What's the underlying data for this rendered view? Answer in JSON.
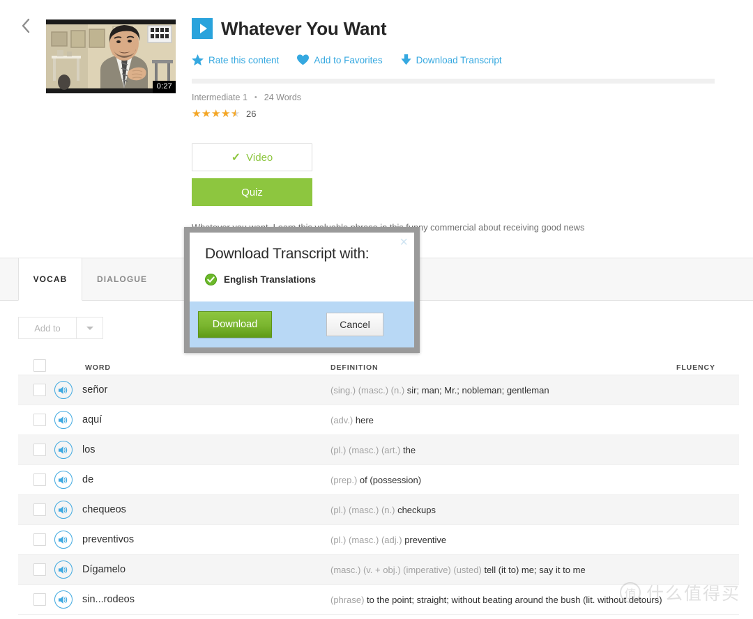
{
  "header": {
    "back_icon": "chevron-left-icon",
    "thumbnail": {
      "duration": "0:27",
      "alt": "video-thumbnail"
    },
    "play_icon": "play-icon",
    "title": "Whatever You Want",
    "actions": [
      {
        "icon": "star-icon",
        "label": "Rate this content"
      },
      {
        "icon": "heart-icon",
        "label": "Add to Favorites"
      },
      {
        "icon": "download-arrow-icon",
        "label": "Download Transcript"
      }
    ],
    "progress_percent": 0,
    "meta": {
      "level": "Intermediate 1",
      "separator": "•",
      "word_count": "24 Words"
    },
    "rating": {
      "value": 4.5,
      "max": 5,
      "count": "26",
      "star_color": "#f5a623"
    },
    "buttons": {
      "video_label": "Video",
      "video_check_icon": "check-icon",
      "quiz_label": "Quiz"
    },
    "description": "Whatever you want. Learn this valuable phrase in this funny commercial about receiving good news"
  },
  "tabs": [
    {
      "label": "VOCAB",
      "active": true
    },
    {
      "label": "DIALOGUE",
      "active": false
    }
  ],
  "toolbar": {
    "add_to_label": "Add to",
    "caret_icon": "chevron-down-icon"
  },
  "table": {
    "columns": [
      "WORD",
      "DEFINITION",
      "FLUENCY"
    ],
    "rows": [
      {
        "word": "señor",
        "pos": "(sing.) (masc.) (n.)",
        "definition": "sir; man; Mr.; nobleman; gentleman"
      },
      {
        "word": "aquí",
        "pos": "(adv.)",
        "definition": "here"
      },
      {
        "word": "los",
        "pos": "(pl.) (masc.) (art.)",
        "definition": "the"
      },
      {
        "word": "de",
        "pos": "(prep.)",
        "definition": "of (possession)"
      },
      {
        "word": "chequeos",
        "pos": "(pl.) (masc.) (n.)",
        "definition": "checkups"
      },
      {
        "word": "preventivos",
        "pos": "(pl.) (masc.) (adj.)",
        "definition": "preventive"
      },
      {
        "word": "Dígamelo",
        "pos": "(masc.) (v. + obj.) (imperative) (usted)",
        "definition": "tell (it to) me; say it to me"
      },
      {
        "word": "sin...rodeos",
        "pos": "(phrase)",
        "definition": "to the point; straight; without beating around the bush (lit. without detours)"
      }
    ],
    "speaker_icon": "speaker-icon"
  },
  "modal": {
    "title": "Download Transcript with:",
    "close_icon": "close-icon",
    "option_icon": "check-circle-icon",
    "option_label": "English Translations",
    "download_label": "Download",
    "cancel_label": "Cancel"
  },
  "watermark": {
    "logo_char": "值",
    "text": "什么值得买"
  }
}
